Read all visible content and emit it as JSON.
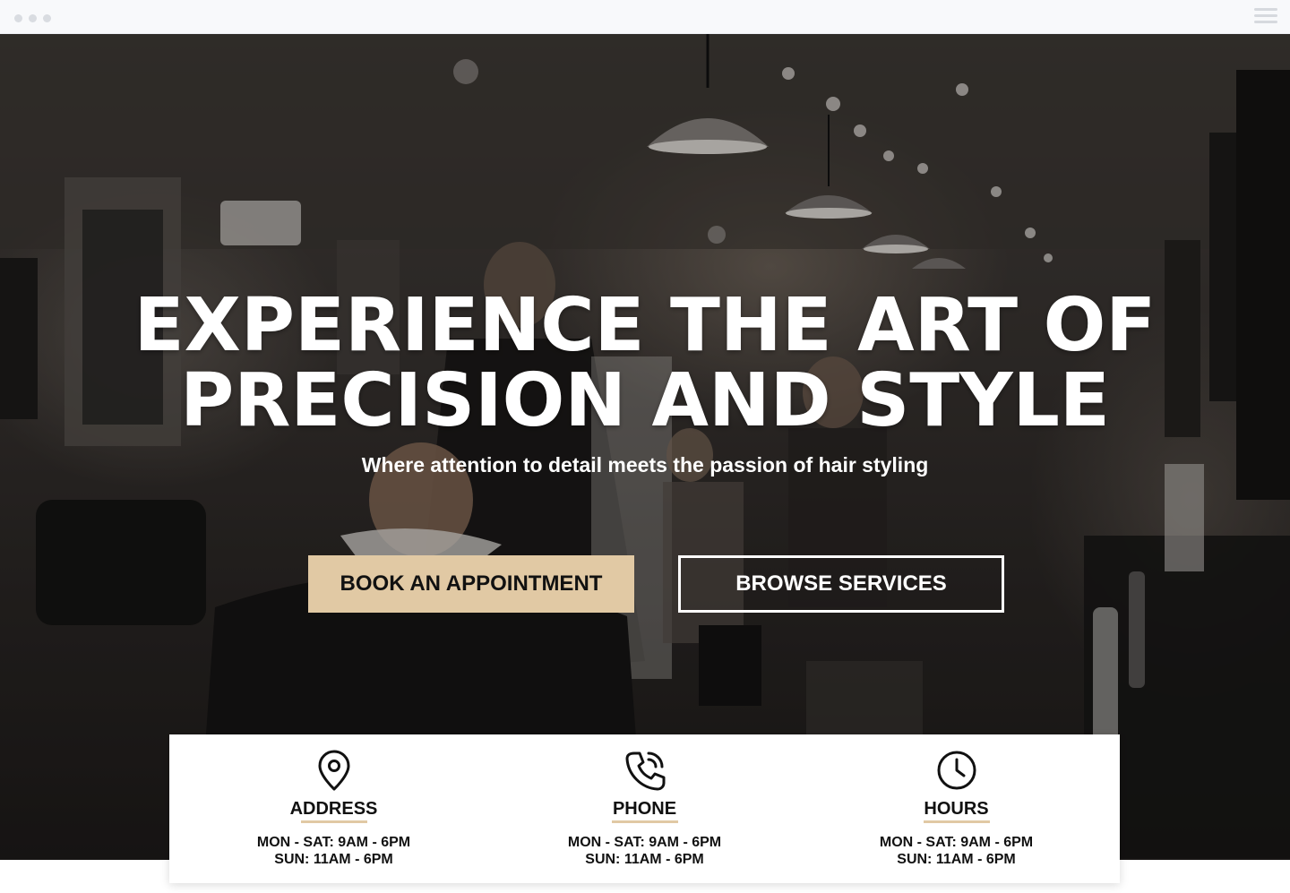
{
  "hero": {
    "headline_line1": "EXPERIENCE THE ART OF",
    "headline_line2": "PRECISION AND STYLE",
    "subheadline": "Where attention to detail meets the passion of hair styling",
    "primary_button": "BOOK AN APPOINTMENT",
    "secondary_button": "BROWSE SERVICES"
  },
  "info": [
    {
      "icon": "location-pin-icon",
      "title": "ADDRESS",
      "line1": "MON - SAT: 9AM - 6PM",
      "line2": "SUN: 11AM - 6PM"
    },
    {
      "icon": "phone-icon",
      "title": "PHONE",
      "line1": "MON - SAT: 9AM - 6PM",
      "line2": "SUN: 11AM - 6PM"
    },
    {
      "icon": "clock-icon",
      "title": "HOURS",
      "line1": "MON - SAT: 9AM - 6PM",
      "line2": "SUN: 11AM - 6PM"
    }
  ],
  "colors": {
    "accent": "#e1c9a4",
    "text_dark": "#111111",
    "hero_overlay": "#2b2725"
  }
}
